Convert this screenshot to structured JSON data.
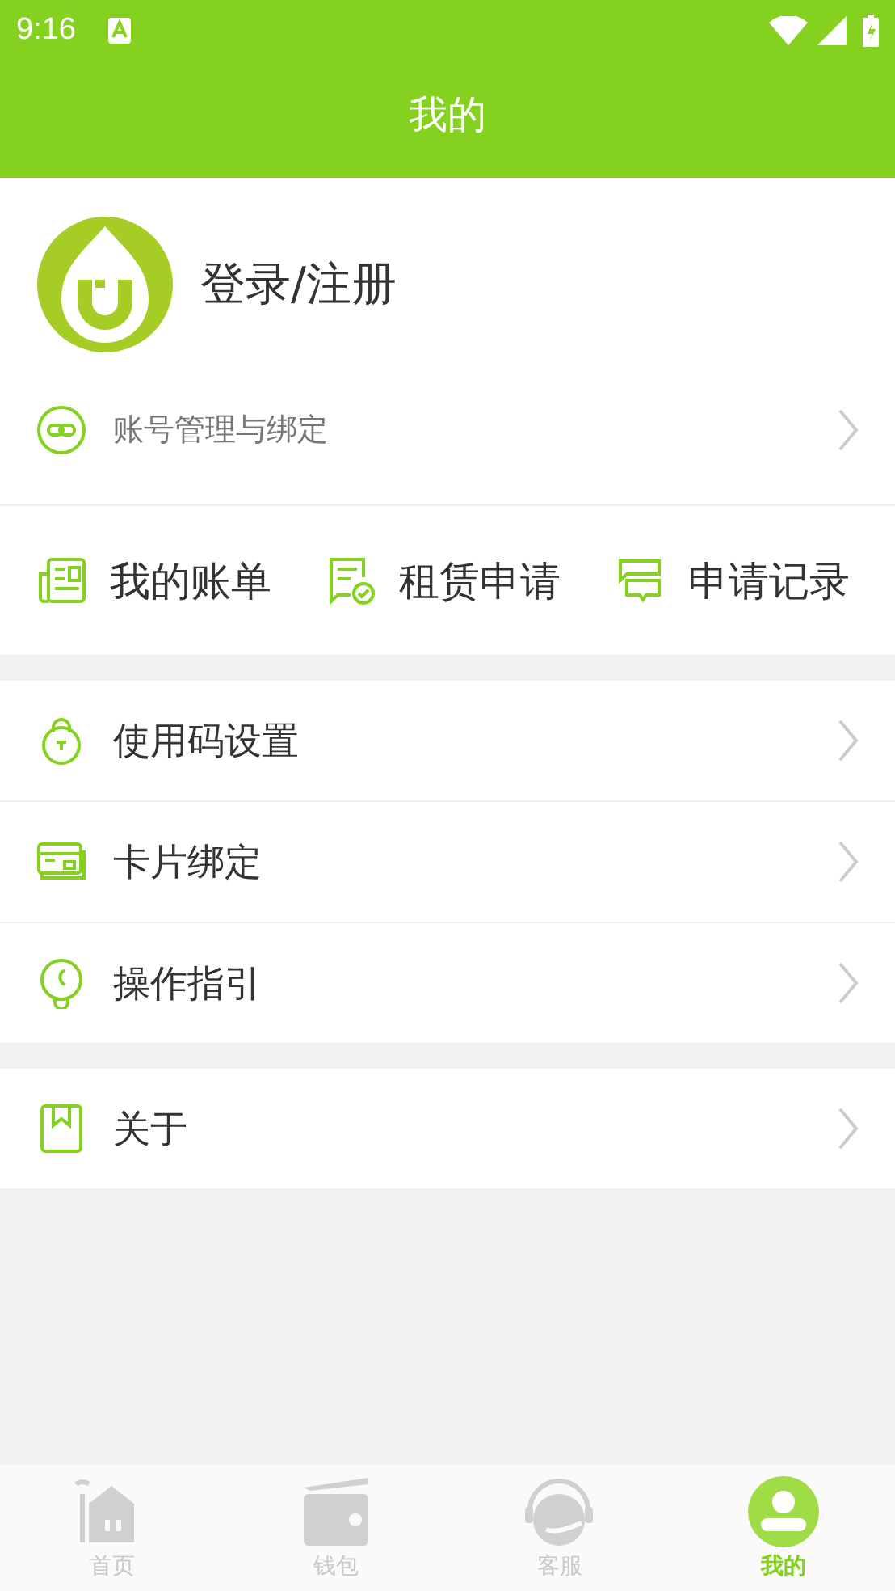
{
  "status_bar": {
    "time": "9:16"
  },
  "header": {
    "title": "我的"
  },
  "profile": {
    "login": "登录/注册",
    "account_link": "账号管理与绑定"
  },
  "shortcuts": [
    {
      "kind": "bill",
      "label": "我的账单"
    },
    {
      "kind": "apply",
      "label": "租赁申请"
    },
    {
      "kind": "record",
      "label": "申请记录"
    }
  ],
  "menu_groups": [
    [
      {
        "kind": "lock",
        "label": "使用码设置"
      },
      {
        "kind": "card",
        "label": "卡片绑定"
      },
      {
        "kind": "bulb",
        "label": "操作指引"
      }
    ],
    [
      {
        "kind": "book",
        "label": "关于"
      }
    ]
  ],
  "tabs": [
    {
      "kind": "home",
      "label": "首页",
      "selected": false
    },
    {
      "kind": "wallet",
      "label": "钱包",
      "selected": false
    },
    {
      "kind": "service",
      "label": "客服",
      "selected": false
    },
    {
      "kind": "me",
      "label": "我的",
      "selected": true
    }
  ]
}
